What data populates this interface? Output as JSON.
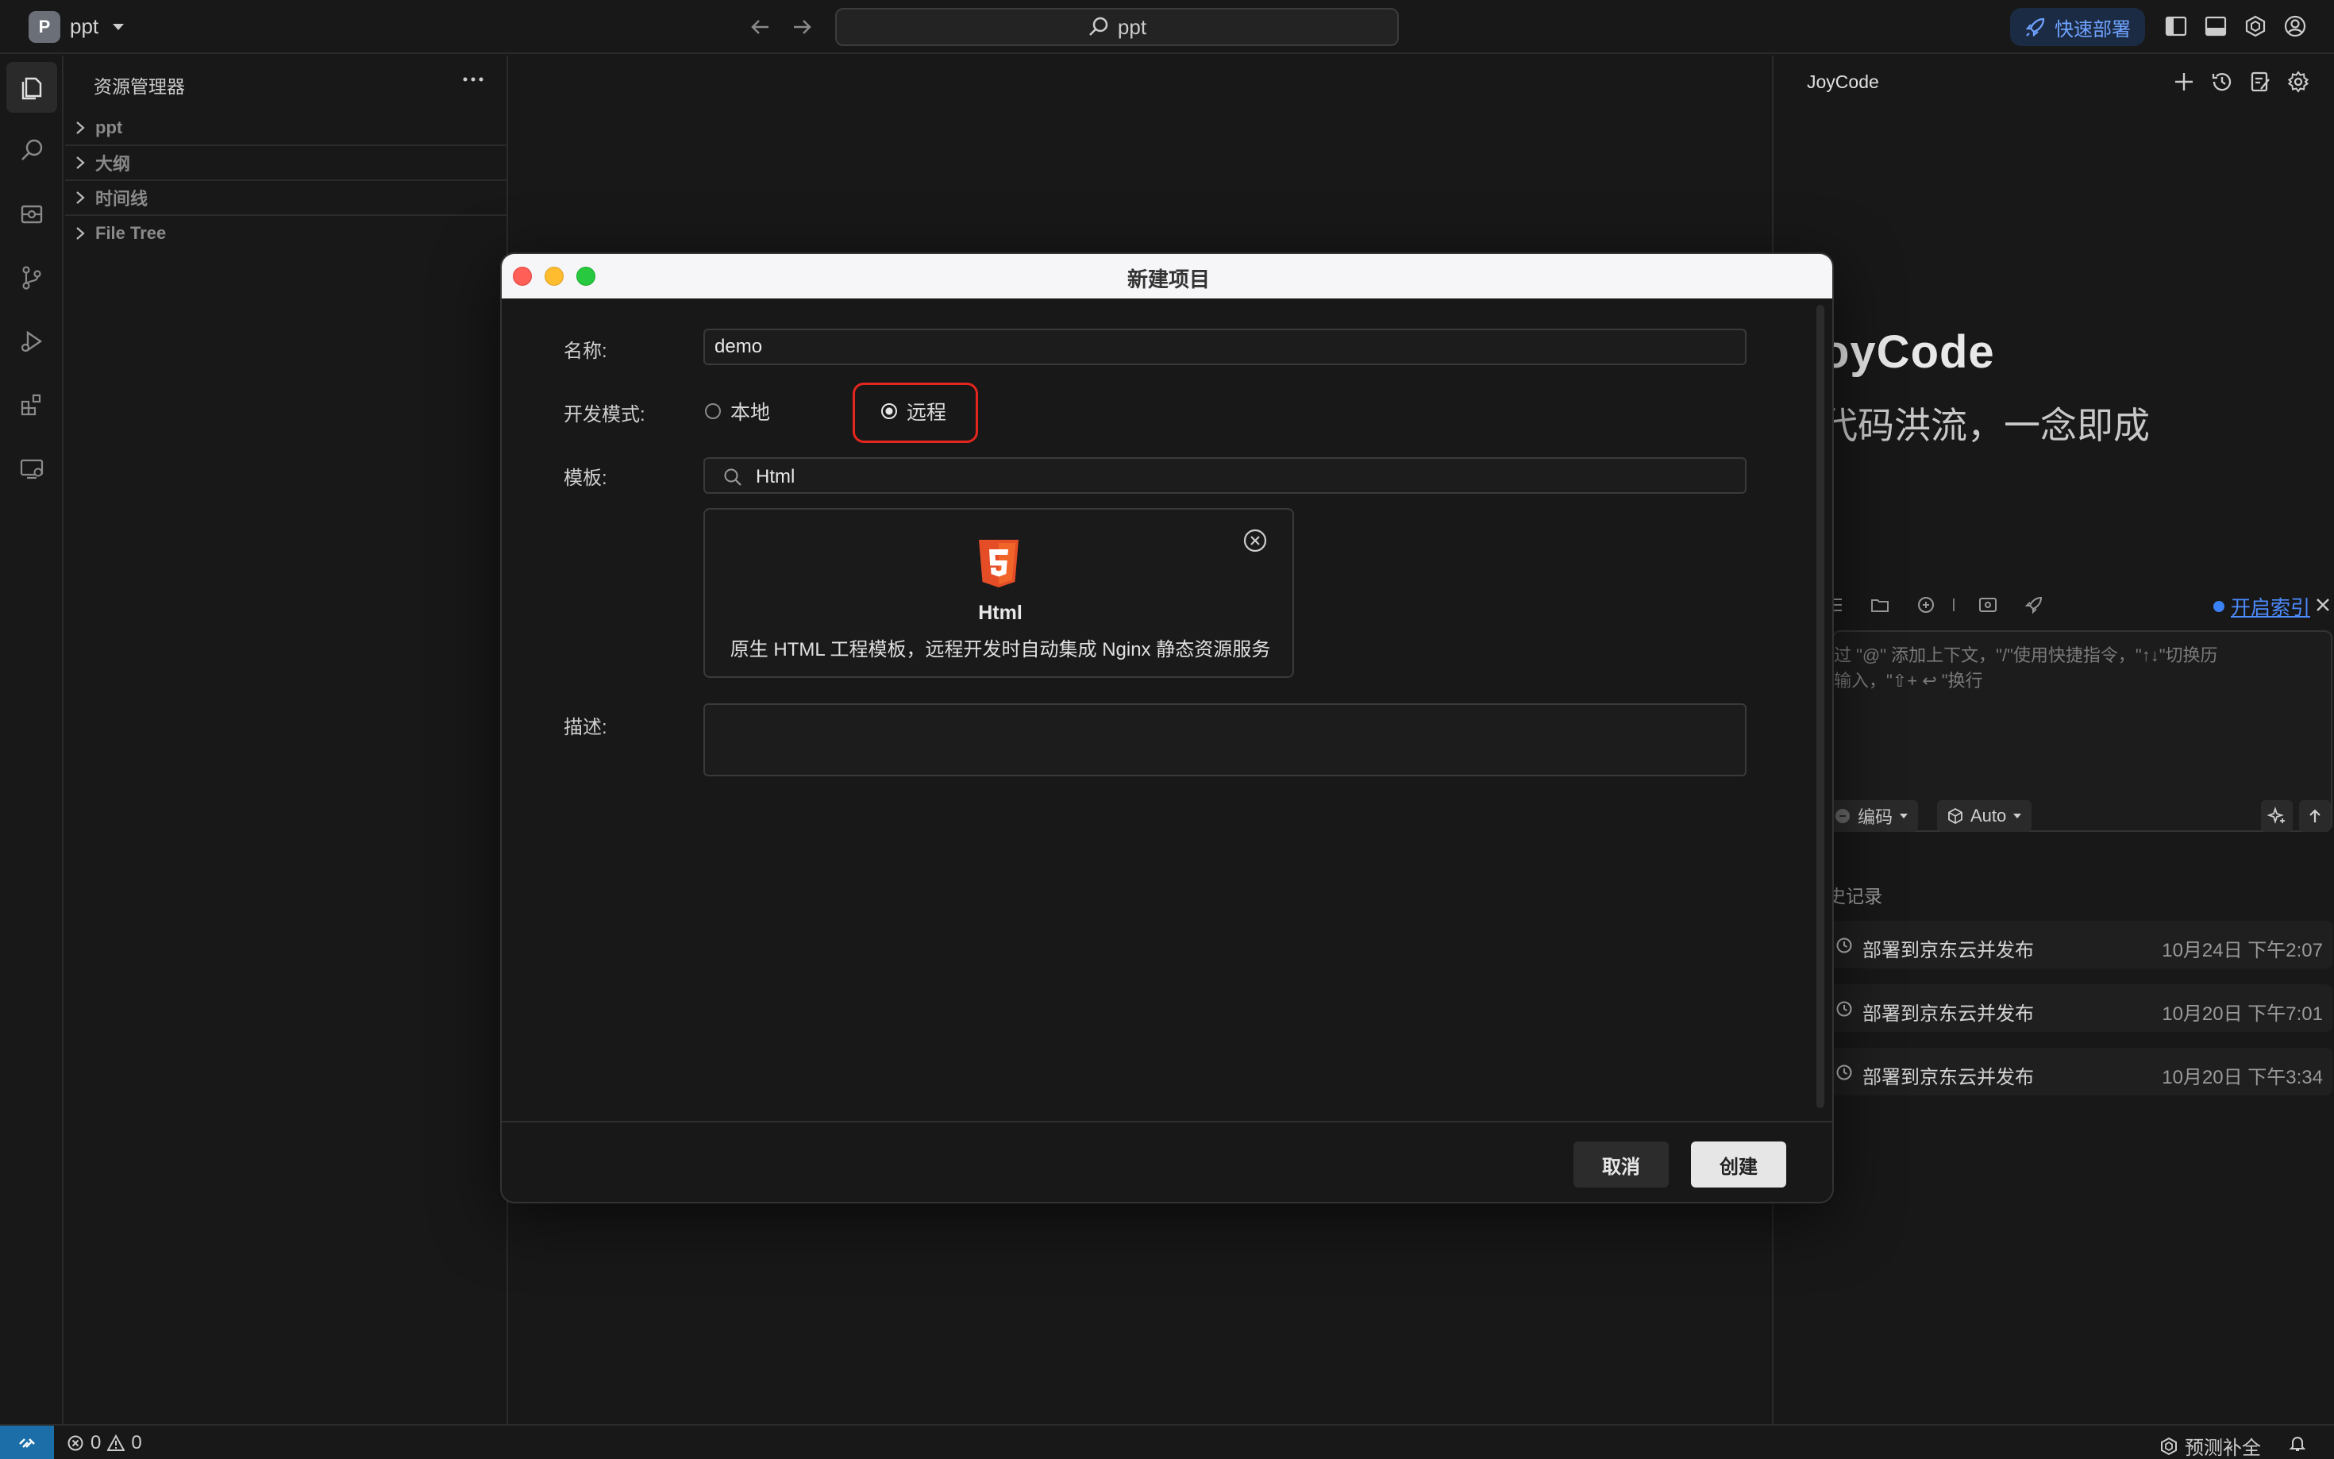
{
  "titlebar": {
    "project_badge": "P",
    "project_name": "ppt",
    "search_text": "ppt",
    "deploy_label": "快速部署"
  },
  "sidebar": {
    "title": "资源管理器",
    "sections": [
      {
        "label": "ppt"
      },
      {
        "label": "大纲"
      },
      {
        "label": "时间线"
      },
      {
        "label": "File Tree"
      }
    ]
  },
  "right_panel": {
    "title": "JoyCode",
    "brand": "oyCode",
    "slogan": "代码洪流，一念即成",
    "index_link": "开启索引",
    "input_placeholder_line1": "过 \"@\" 添加上下文，\"/\"使用快捷指令，\"↑↓\"切换历",
    "input_placeholder_line2": "输入，\"⇧+ ↩ \"换行",
    "mode_label": "编码",
    "model_label": "Auto",
    "history_label": "史记录",
    "history": [
      {
        "text": "部署到京东云并发布",
        "time": "10月24日 下午2:07"
      },
      {
        "text": "部署到京东云并发布",
        "time": "10月20日 下午7:01"
      },
      {
        "text": "部署到京东云并发布",
        "time": "10月20日 下午3:34"
      }
    ]
  },
  "modal": {
    "title": "新建项目",
    "name_label": "名称:",
    "name_value": "demo",
    "mode_label": "开发模式:",
    "mode_local": "本地",
    "mode_remote": "远程",
    "template_label": "模板:",
    "template_search": "Html",
    "template_card": {
      "name": "Html",
      "description": "原生 HTML 工程模板，远程开发时自动集成 Nginx 静态资源服务"
    },
    "description_label": "描述:",
    "cancel_label": "取消",
    "create_label": "创建"
  },
  "statusbar": {
    "errors": "0",
    "warnings": "0",
    "completion_label": "预测补全"
  },
  "colors": {
    "accent_blue": "#4d8cff",
    "highlight_red": "#e3261e",
    "html5_orange": "#e44d26"
  }
}
